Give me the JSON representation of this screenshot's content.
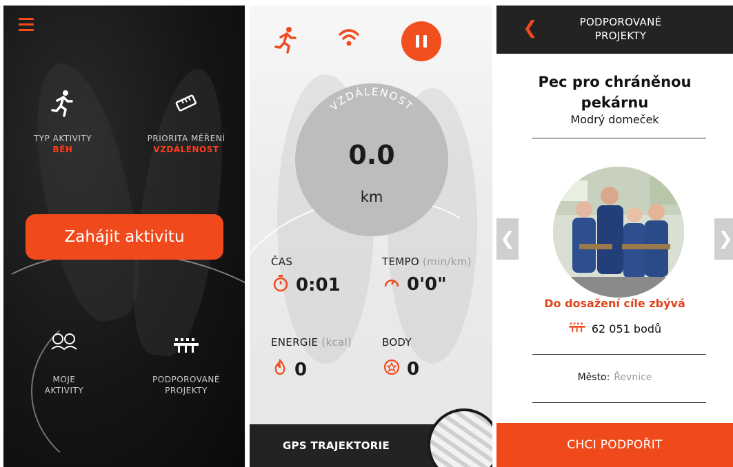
{
  "screen1": {
    "activity_type_label": "TYP AKTIVITY",
    "activity_type_value": "BĚH",
    "priority_label": "PRIORITA MĚŘENÍ",
    "priority_value": "VZDÁLENOST",
    "start_button": "Zahájit aktivitu",
    "my_activities_line1": "MOJE",
    "my_activities_line2": "AKTIVITY",
    "supported_projects_line1": "PODPOROVANÉ",
    "supported_projects_line2": "PROJEKTY",
    "icons": [
      "menu-icon",
      "running-icon",
      "ruler-icon",
      "friends-icon",
      "bench-icon"
    ]
  },
  "screen2": {
    "distance_label": "VZDÁLENOST",
    "distance_value": "0.0",
    "distance_unit": "km",
    "time_label": "ČAS",
    "time_value": "0:01",
    "tempo_label": "TEMPO",
    "tempo_unit": "(min/km)",
    "tempo_value": "0'0\"",
    "energy_label": "ENERGIE",
    "energy_unit": "(kcal)",
    "energy_value": "0",
    "points_label": "BODY",
    "points_value": "0",
    "gps_label": "GPS TRAJEKTORIE"
  },
  "screen3": {
    "header_line1": "PODPOROVANÉ",
    "header_line2": "PROJEKTY",
    "project_title_line1": "Pec pro chráněnou",
    "project_title_line2": "pekárnu",
    "project_org": "Modrý domeček",
    "goal_text": "Do dosažení cíle zbývá",
    "points_remaining": "62 051 bodů",
    "city_label": "Město:",
    "city_value": "Řevnice",
    "support_button": "CHCI PODPOŘIT"
  },
  "colors": {
    "accent": "#f04a1c",
    "dark": "#232323",
    "circle": "#bdbdbd"
  }
}
